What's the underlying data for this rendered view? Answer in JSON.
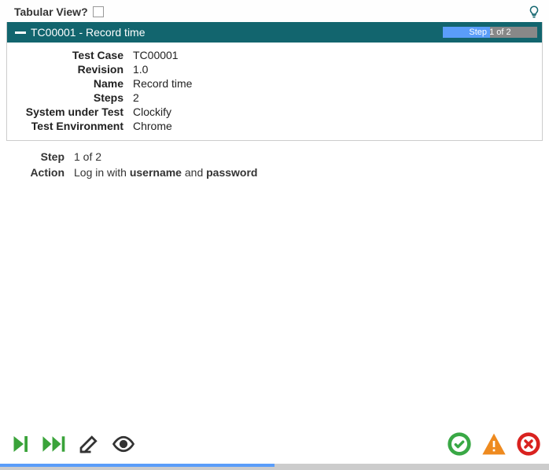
{
  "top": {
    "tabular_view_label": "Tabular View?"
  },
  "panel": {
    "title": "TC00001 - Record time",
    "step_indicator": "Step 1 of 2"
  },
  "details": {
    "labels": {
      "test_case": "Test Case",
      "revision": "Revision",
      "name": "Name",
      "steps": "Steps",
      "sut": "System under Test",
      "env": "Test Environment"
    },
    "values": {
      "test_case": "TC00001",
      "revision": "1.0",
      "name": "Record time",
      "steps": "2",
      "sut": "Clockify",
      "env": "Chrome"
    }
  },
  "step": {
    "labels": {
      "step": "Step",
      "action": "Action"
    },
    "step_text": "1 of 2",
    "action_prefix": "Log in with ",
    "action_b1": "username",
    "action_mid": " and ",
    "action_b2": "password"
  },
  "colors": {
    "header": "#12656e",
    "accent": "#5a9df9",
    "green": "#3aa33a",
    "dark": "#333",
    "ok": "#39a845",
    "warn": "#ee8a1f",
    "err": "#d9221f"
  }
}
